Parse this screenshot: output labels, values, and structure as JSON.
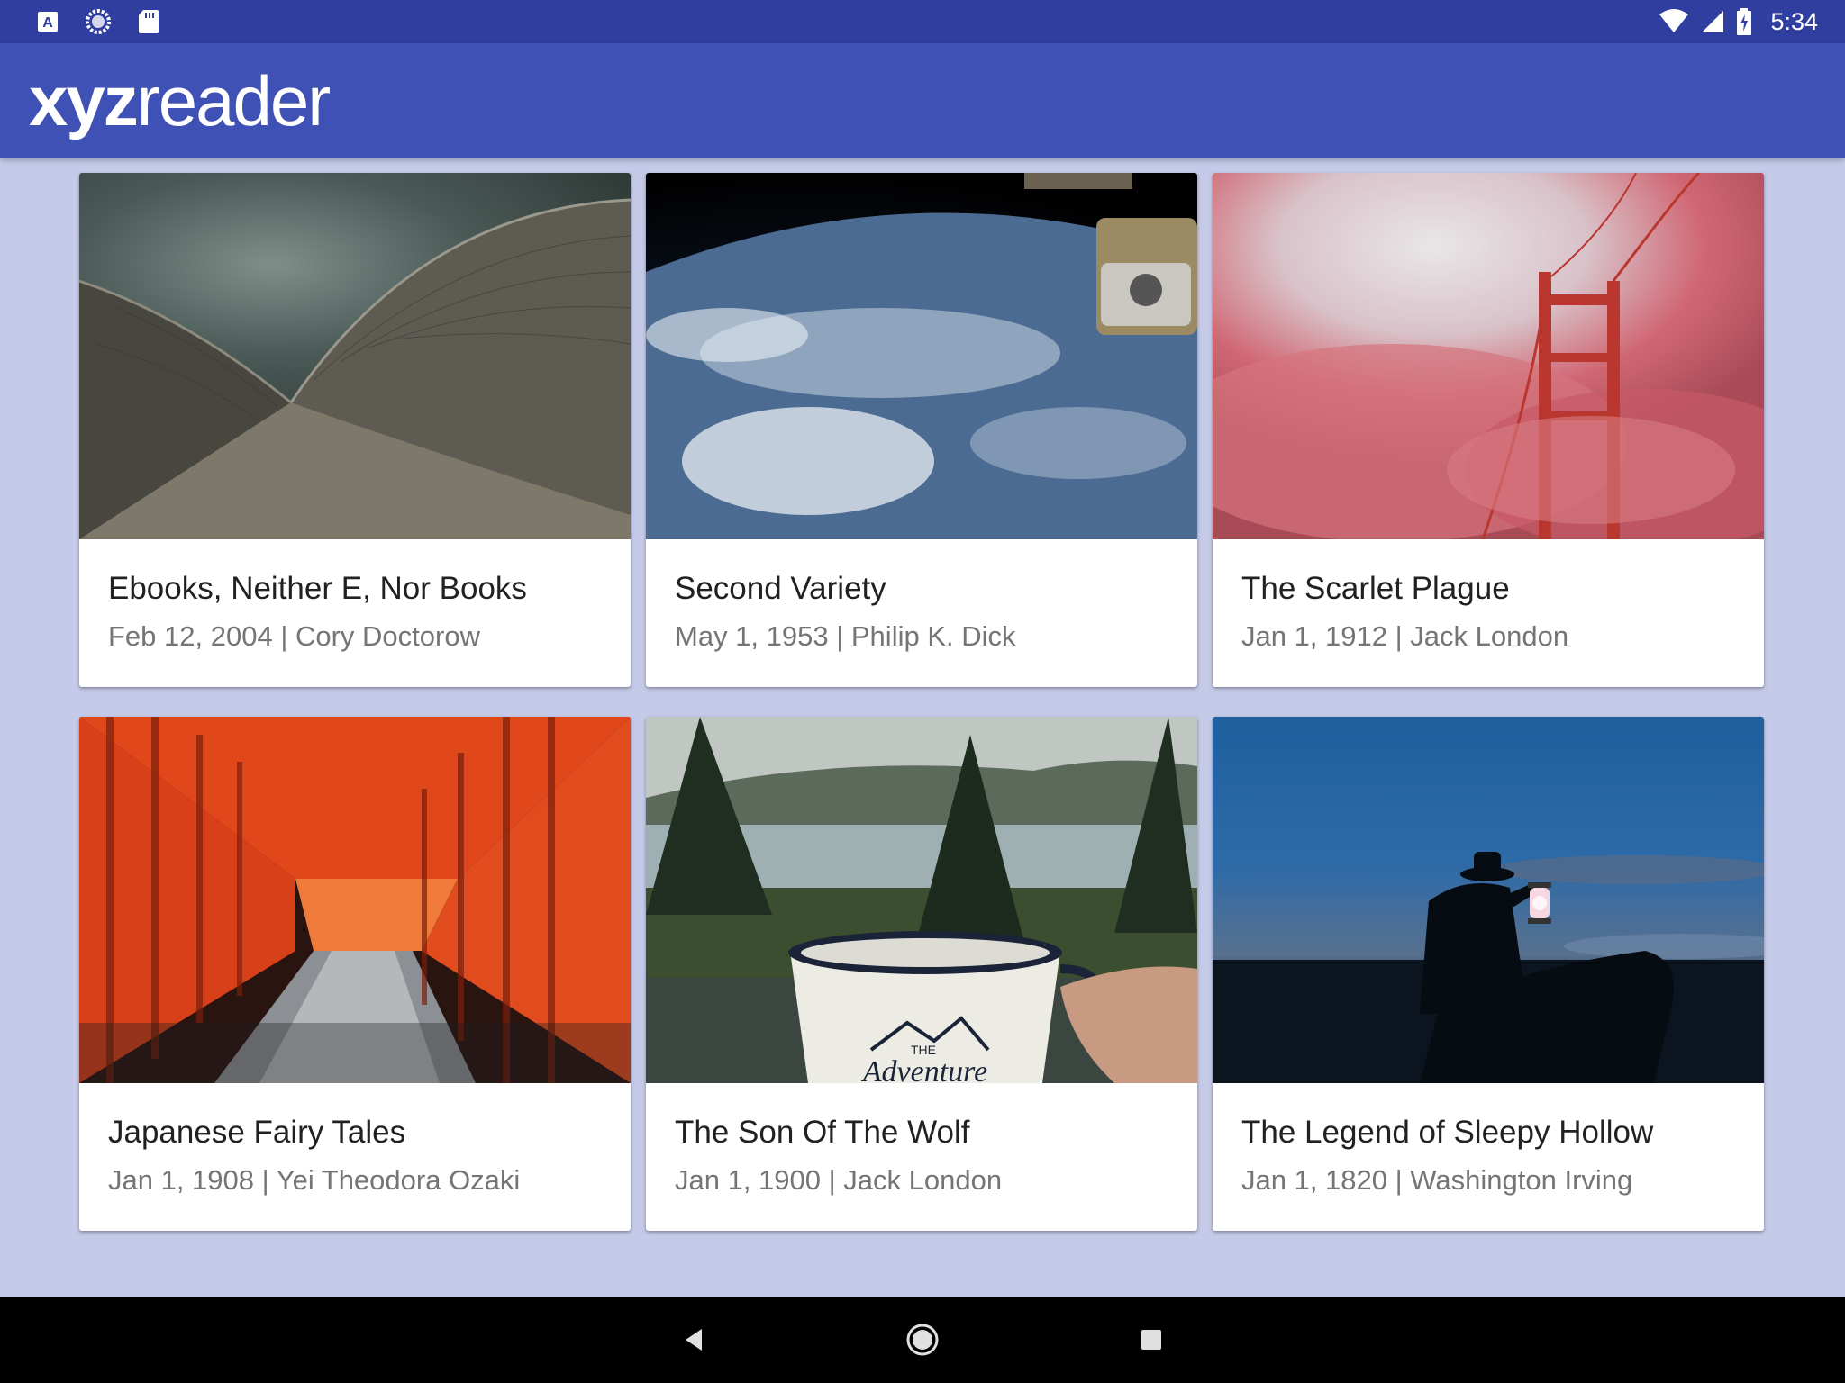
{
  "status_bar": {
    "time": "5:34",
    "icons_left": [
      "app-notification-icon",
      "sync-icon",
      "sd-card-icon"
    ],
    "icons_right": [
      "wifi-icon",
      "signal-icon",
      "battery-icon"
    ]
  },
  "app_bar": {
    "logo_bold": "xyz",
    "logo_light": "reader",
    "color": "#3f51b5"
  },
  "colors": {
    "status_bar": "#303f9f",
    "background": "#c5cae9",
    "title_text": "#212121",
    "subtitle_text": "#757575"
  },
  "articles": [
    {
      "title": "Ebooks, Neither E, Nor Books",
      "subtitle": "Feb 12, 2004 | Cory Doctorow",
      "image": "opera-house-roof"
    },
    {
      "title": "Second Variety",
      "subtitle": "May 1, 1953 | Philip K. Dick",
      "image": "earth-from-space-station"
    },
    {
      "title": "The Scarlet Plague",
      "subtitle": "Jan 1, 1912 | Jack London",
      "image": "golden-gate-bridge-in-fog"
    },
    {
      "title": "Japanese Fairy Tales",
      "subtitle": "Jan 1, 1908 | Yei Theodora Ozaki",
      "image": "torii-gates-path"
    },
    {
      "title": "The Son Of The Wolf",
      "subtitle": "Jan 1, 1900 | Jack London",
      "image": "adventure-mug-lake"
    },
    {
      "title": "The Legend of Sleepy Hollow",
      "subtitle": "Jan 1, 1820 | Washington Irving",
      "image": "rider-with-lantern-night"
    }
  ],
  "mug_text": {
    "small": "THE",
    "script": "Adventure"
  },
  "nav_bar": {
    "buttons": [
      "back-icon",
      "home-icon",
      "recents-icon"
    ]
  }
}
